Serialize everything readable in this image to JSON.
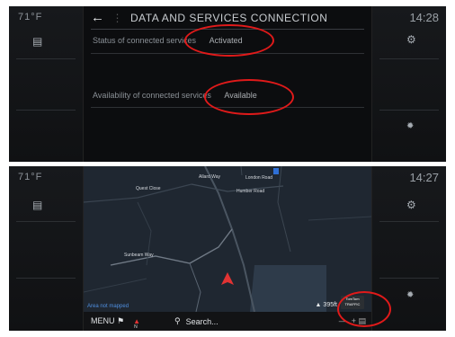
{
  "top_screen": {
    "temperature": "71°F",
    "title": "DATA AND SERVICES CONNECTION",
    "clock": "14:28",
    "rows": [
      {
        "label": "Status of connected services",
        "value": "Activated"
      },
      {
        "label": "Availability of connected services",
        "value": "Available"
      }
    ]
  },
  "bottom_screen": {
    "temperature": "71°F",
    "clock": "14:27",
    "map_labels": [
      "Allard Way",
      "London Road",
      "Quest Close",
      "Humber Road",
      "Sunbeam Way"
    ],
    "status_text": "Area not mapped",
    "scale": "395ft",
    "tomtom_line1": "TomTom",
    "tomtom_line2": "TRAFFIC",
    "menu_label": "MENU",
    "search_label": "Search...",
    "compass_label": "N"
  },
  "accent_colors": {
    "highlight_ring": "#e01a1a",
    "vehicle_arrow": "#e23333",
    "status_text": "#4f8fe0"
  }
}
